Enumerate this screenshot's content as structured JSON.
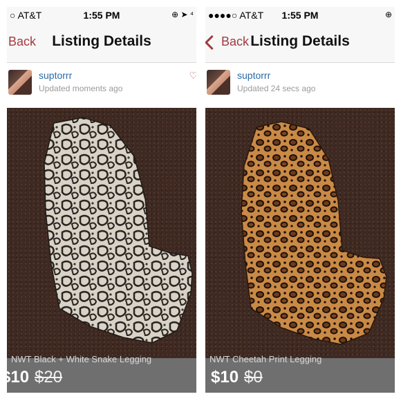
{
  "panels": [
    {
      "status": {
        "carrier": "○ AT&T",
        "time": "1:55 PM",
        "icons": "⊕ ➤ ⁴"
      },
      "nav": {
        "back_label": "Back",
        "title": "Listing Details"
      },
      "seller": {
        "name": "suptorrr",
        "updated": "Updated moments ago"
      },
      "price": {
        "current": "$10",
        "original": "$20"
      },
      "listing_title": "NWT Black + White Snake Legging"
    },
    {
      "status": {
        "carrier": "●●●●○ AT&T",
        "time": "1:55 PM",
        "icons": "⊕"
      },
      "nav": {
        "back_label": "Back",
        "title": "Listing Details"
      },
      "seller": {
        "name": "suptorrr",
        "updated": "Updated 24 secs ago"
      },
      "price": {
        "current": "$10",
        "original": "$0"
      },
      "listing_title": "NWT Cheetah Print Legging"
    }
  ],
  "colors": {
    "accent": "#a23b3f",
    "link": "#2b6aa3",
    "price_bar": "#6f6f6f"
  }
}
